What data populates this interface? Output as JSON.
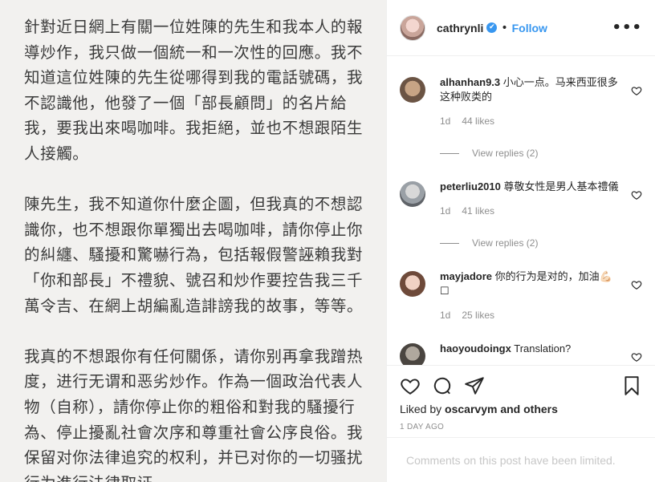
{
  "post": {
    "paragraphs": [
      "針對近日網上有關一位姓陳的先生和我本人的報導炒作，我只做一個統一和一次性的回應。我不知道這位姓陳的先生從哪得到我的電話號碼，我不認識他，他發了一個「部長顧問」的名片給我，要我出來喝咖啡。我拒絕，並也不想跟陌生人接觸。",
      "陳先生，我不知道你什麼企圖，但我真的不想認識你，也不想跟你單獨出去喝咖啡，請你停止你的糾纏、騷擾和驚嚇行為，包括報假警誣賴我對「你和部長」不禮貌、號召和炒作要控告我三千萬令吉、在網上胡編亂造誹謗我的故事，等等。",
      "我真的不想跟你有任何關係，请你别再拿我蹭热度，进行无谓和恶劣炒作。作為一個政治代表人物（自称），請你停止你的粗俗和對我的騷擾行為、停止擾亂社會次序和尊重社會公序良俗。我保留对你法律追究的权利，并已对你的一切骚扰行为進行法律取证。"
    ]
  },
  "header": {
    "username": "cathrynli",
    "verified_glyph": "✔",
    "dot": "•",
    "follow_label": "Follow",
    "more_glyph": "•••"
  },
  "comments": [
    {
      "user": "alhanhan9.3",
      "text": "小心一点。马来西亚很多这种败类的",
      "time": "1d",
      "likes": "44 likes",
      "replies": "View replies (2)"
    },
    {
      "user": "peterliu2010",
      "text": "尊敬女性是男人基本禮儀",
      "time": "1d",
      "likes": "41 likes",
      "replies": "View replies (2)"
    },
    {
      "user": "mayjadore",
      "text": "你的行为是对的，加油💪🏻☐",
      "time": "1d",
      "likes": "25 likes"
    },
    {
      "user": "haoyoudoingx",
      "text": "Translation?"
    }
  ],
  "actions": {
    "liked_prefix": "Liked by ",
    "liked_user": "oscarvym",
    "liked_suffix": " and others",
    "timestamp": "1 DAY AGO",
    "limited_notice": "Comments on this post have been limited."
  },
  "colors": {
    "accent": "#3897f0",
    "muted": "#8e8e8e",
    "post_bg": "#f2f1ef"
  },
  "icons": [
    "heart-icon",
    "comment-icon",
    "share-icon",
    "bookmark-icon",
    "more-icon",
    "verified-icon"
  ]
}
